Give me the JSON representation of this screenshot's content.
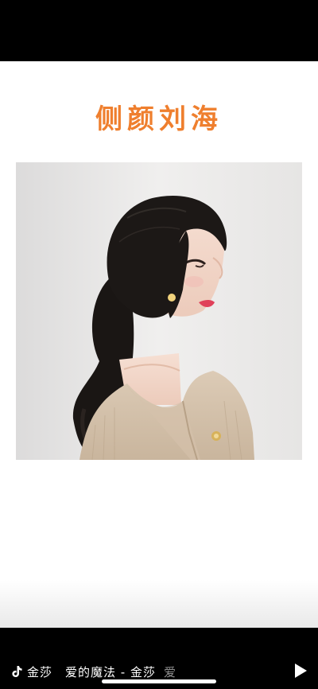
{
  "post": {
    "title": "侧颜刘海"
  },
  "music": {
    "artist": "金莎",
    "song": "爱的魔法 - 金莎",
    "marquee_tail": "爱"
  },
  "icons": {
    "music": "tiktok-note-icon",
    "play": "play-icon"
  },
  "colors": {
    "title": "#ef7f2e",
    "background": "#ffffff",
    "bars": "#000000"
  }
}
